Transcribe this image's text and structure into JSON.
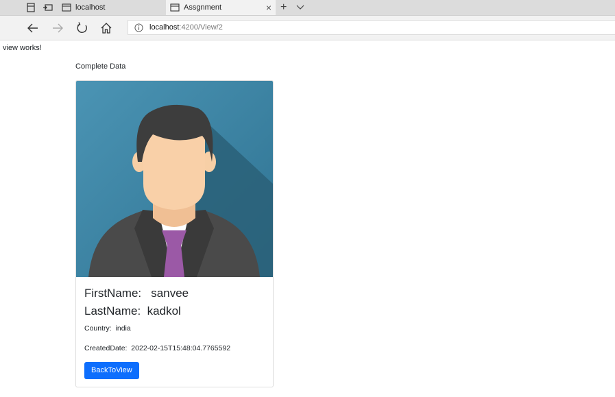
{
  "browser": {
    "tabs": [
      {
        "title": "localhost",
        "active": false
      },
      {
        "title": "Assgnment",
        "active": true
      }
    ],
    "new_tab_glyph": "+",
    "close_glyph": "×",
    "address": {
      "host": "localhost",
      "path": ":4200/View/2"
    },
    "icons": [
      "tab-preview-icon",
      "set-aside-tabs-icon",
      "tab-page-icon",
      "tab-list-chevron-icon",
      "back-arrow-icon",
      "forward-arrow-icon",
      "refresh-icon",
      "home-icon",
      "site-info-icon"
    ]
  },
  "page": {
    "status_text": "view works!",
    "heading": "Complete Data",
    "card": {
      "image_icon": "person-avatar-icon",
      "first_name_label": "FirstName:",
      "first_name": "sanvee",
      "last_name_label": "LastName:",
      "last_name": "kadkol",
      "country_label": "Country:",
      "country": "india",
      "created_label": "CreatedDate:",
      "created": "2022-02-15T15:48:04.7765592",
      "button_label": "BackToView"
    }
  },
  "colors": {
    "button": "#0d6efd",
    "avatar_bg": "#3d88a8",
    "tie": "#9b59a6",
    "suit": "#4a4a4a"
  }
}
